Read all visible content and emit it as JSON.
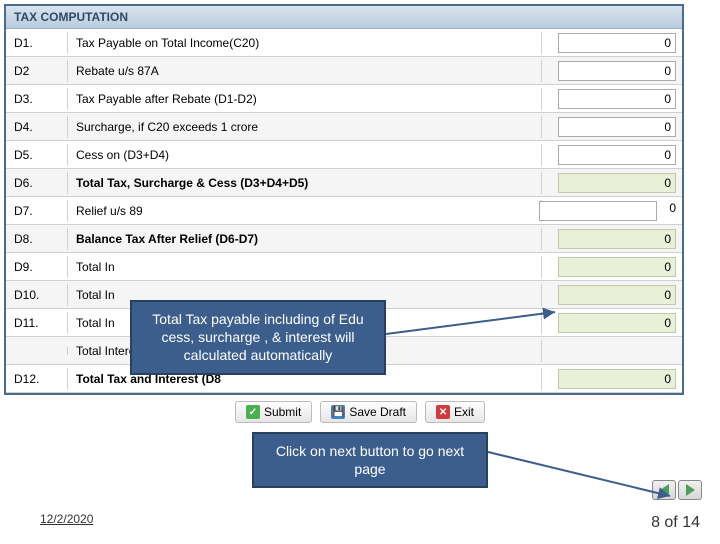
{
  "header": {
    "title": "TAX COMPUTATION"
  },
  "rows": [
    {
      "code": "D1.",
      "label": "Tax Payable on Total Income(C20)",
      "bold": false,
      "value": "0",
      "kind": "input"
    },
    {
      "code": "D2",
      "label": "Rebate u/s 87A",
      "bold": false,
      "value": "0",
      "kind": "input"
    },
    {
      "code": "D3.",
      "label": "Tax Payable after Rebate (D1-D2)",
      "bold": false,
      "value": "0",
      "kind": "input"
    },
    {
      "code": "D4.",
      "label": "Surcharge, if C20 exceeds 1 crore",
      "bold": false,
      "value": "0",
      "kind": "input"
    },
    {
      "code": "D5.",
      "label": "Cess on (D3+D4)",
      "bold": false,
      "value": "0",
      "kind": "input"
    },
    {
      "code": "D6.",
      "label": "Total Tax, Surcharge & Cess (D3+D4+D5)",
      "bold": true,
      "value": "0",
      "kind": "readonly"
    },
    {
      "code": "D7.",
      "label": "Relief u/s 89",
      "bold": false,
      "value": "0",
      "kind": "input-plain"
    },
    {
      "code": "D8.",
      "label": "Balance Tax After Relief (D6-D7)",
      "bold": true,
      "value": "0",
      "kind": "readonly"
    },
    {
      "code": "D9.",
      "label": "Total In",
      "bold": false,
      "value": "0",
      "kind": "readonly"
    },
    {
      "code": "D10.",
      "label": "Total In",
      "bold": false,
      "value": "0",
      "kind": "readonly"
    },
    {
      "code": "D11.",
      "label": "Total In",
      "bold": false,
      "value": "0",
      "kind": "readonly"
    },
    {
      "code": "",
      "label": "Total Interest Payable ( D9 + D10 + D11 )",
      "bold": false,
      "value": "",
      "kind": "none"
    },
    {
      "code": "D12.",
      "label": "Total Tax and Interest (D8",
      "bold": true,
      "value": "0",
      "kind": "readonly"
    }
  ],
  "buttons": {
    "submit": "Submit",
    "save_draft": "Save Draft",
    "exit": "Exit"
  },
  "callouts": {
    "c1": "Total Tax payable including of Edu cess, surcharge , & interest  will calculated automatically",
    "c2": "Click on next button to go next page"
  },
  "footer": {
    "date": "12/2/2020",
    "page": "8 of 14"
  }
}
